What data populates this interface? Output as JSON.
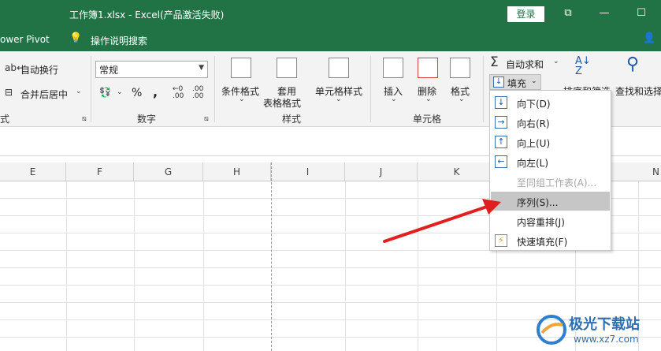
{
  "titlebar": {
    "title": "工作簿1.xlsx  -  Excel(产品激活失败)",
    "login": "登录",
    "restore": "⧉",
    "minimize": "—",
    "maximize": "☐"
  },
  "tellbar": {
    "powerpivot": "ower Pivot",
    "search": "操作说明搜索"
  },
  "ribbon": {
    "wrap_text": "自动换行",
    "merge_center": "合并后居中",
    "align_group_tail": "式",
    "number_format": "常规",
    "percent": "%",
    "comma": ",",
    "inc_decimal": ".00",
    "dec_decimal": ".00",
    "number_group": "数字",
    "cond_format": "条件格式",
    "table_format": "套用",
    "table_format2": "表格格式",
    "cell_style": "单元格样式",
    "styles_group": "样式",
    "insert": "插入",
    "delete": "删除",
    "format": "格式",
    "cells_group": "单元格",
    "autosum": "自动求和",
    "fill": "填充",
    "sort_filter": "排序和筛选",
    "find_select": "查找和选择"
  },
  "columns": [
    "E",
    "F",
    "G",
    "H",
    "I",
    "J",
    "K",
    "N"
  ],
  "fill_menu": {
    "items": [
      {
        "label": "向下(D)",
        "icon": "arrow-down-icon",
        "glyph": "↓"
      },
      {
        "label": "向右(R)",
        "icon": "arrow-right-icon",
        "glyph": "→"
      },
      {
        "label": "向上(U)",
        "icon": "arrow-up-icon",
        "glyph": "↑"
      },
      {
        "label": "向左(L)",
        "icon": "arrow-left-icon",
        "glyph": "←"
      },
      {
        "label": "至同组工作表(A)...",
        "disabled": true
      },
      {
        "label": "序列(S)...",
        "highlighted": true
      },
      {
        "label": "内容重排(J)"
      },
      {
        "label": "快速填充(F)",
        "icon": "flash-fill-icon",
        "glyph": "⚡"
      }
    ]
  },
  "watermark": {
    "brand": "极光下载站",
    "url": "www.xz7.com"
  },
  "colors": {
    "excel_green": "#217346",
    "annotation_red": "#e0201e"
  }
}
